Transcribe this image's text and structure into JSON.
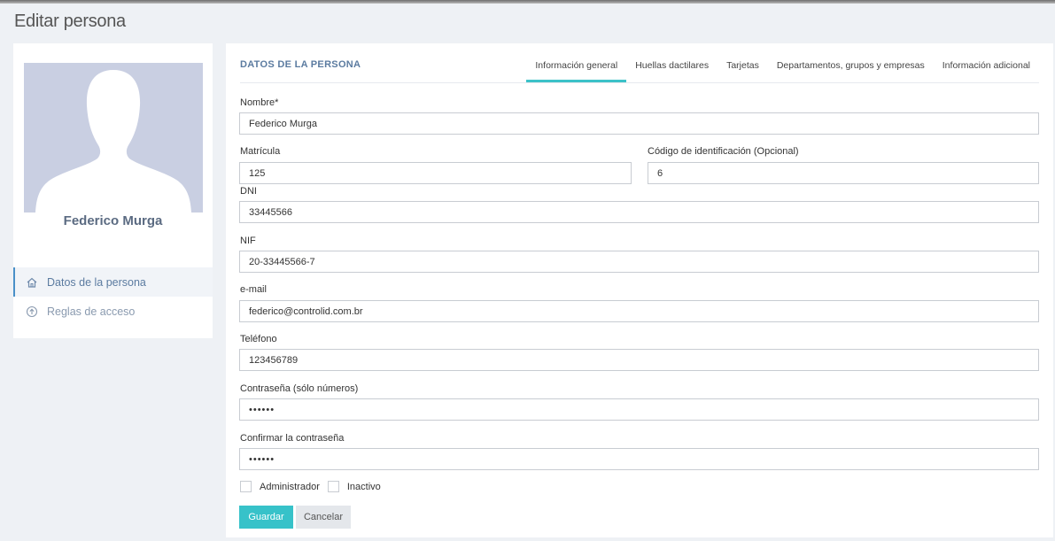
{
  "page": {
    "title": "Editar persona"
  },
  "profile": {
    "name": "Federico Murga",
    "nav": [
      {
        "label": "Datos de la persona",
        "icon": "home-icon",
        "active": true
      },
      {
        "label": "Reglas de acceso",
        "icon": "arrow-up-circle-icon",
        "active": false
      }
    ]
  },
  "form": {
    "section_title": "DATOS DE LA PERSONA",
    "tabs": [
      {
        "label": "Información general",
        "active": true
      },
      {
        "label": "Huellas dactilares"
      },
      {
        "label": "Tarjetas"
      },
      {
        "label": "Departamentos, grupos y empresas"
      },
      {
        "label": "Información adicional"
      }
    ],
    "fields": {
      "nombre": {
        "label": "Nombre*",
        "value": "Federico Murga"
      },
      "matricula": {
        "label": "Matrícula",
        "value": "125"
      },
      "codigo": {
        "label": "Código de identificación (Opcional)",
        "value": "6"
      },
      "dni": {
        "label": "DNI",
        "value": "33445566"
      },
      "nif": {
        "label": "NIF",
        "value": "20-33445566-7"
      },
      "email": {
        "label": "e-mail",
        "value": "federico@controlid.com.br"
      },
      "telefono": {
        "label": "Teléfono",
        "value": "123456789"
      },
      "password": {
        "label": "Contraseña (sólo números)",
        "value": "••••••"
      },
      "confirm": {
        "label": "Confirmar la contraseña",
        "value": "••••••"
      }
    },
    "checkboxes": {
      "admin": {
        "label": "Administrador",
        "checked": false
      },
      "inactive": {
        "label": "Inactivo",
        "checked": false
      }
    },
    "buttons": {
      "save": "Guardar",
      "cancel": "Cancelar"
    }
  },
  "colors": {
    "accent": "#37c2c9",
    "link": "#5b7ba0",
    "avatar_bg": "#c9cfe2"
  }
}
